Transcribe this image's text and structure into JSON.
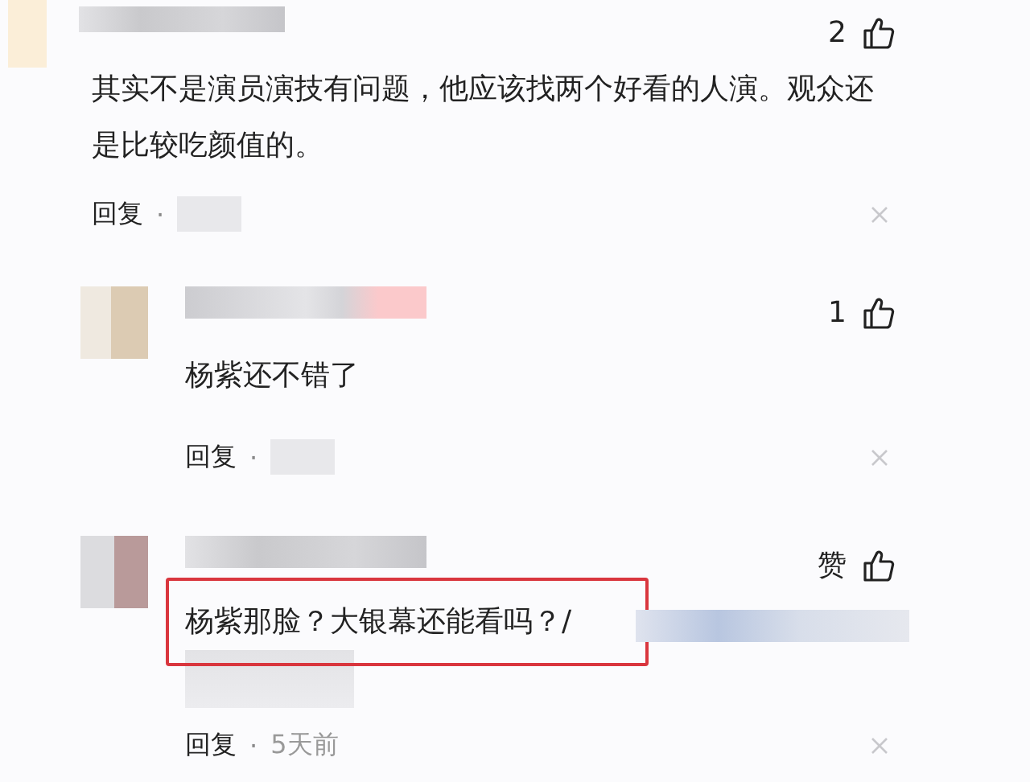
{
  "comments": [
    {
      "kind": "comment",
      "likes": "2",
      "text": "其实不是演员演技有问题，他应该找两个好看的人演。观众还是比较吃颜值的。",
      "highlighted": false,
      "redacted_tail": false,
      "reply": "回复",
      "separator": "·"
    },
    {
      "kind": "reply",
      "likes": "1",
      "text": "杨紫还不错了",
      "highlighted": false,
      "redacted_tail": false,
      "reply": "回复",
      "separator": "·"
    },
    {
      "kind": "reply",
      "likes": "赞",
      "text": "杨紫那脸？大银幕还能看吗？/",
      "highlighted": true,
      "redacted_tail": true,
      "reply": "回复",
      "separator": "·",
      "time": "5天前"
    }
  ]
}
